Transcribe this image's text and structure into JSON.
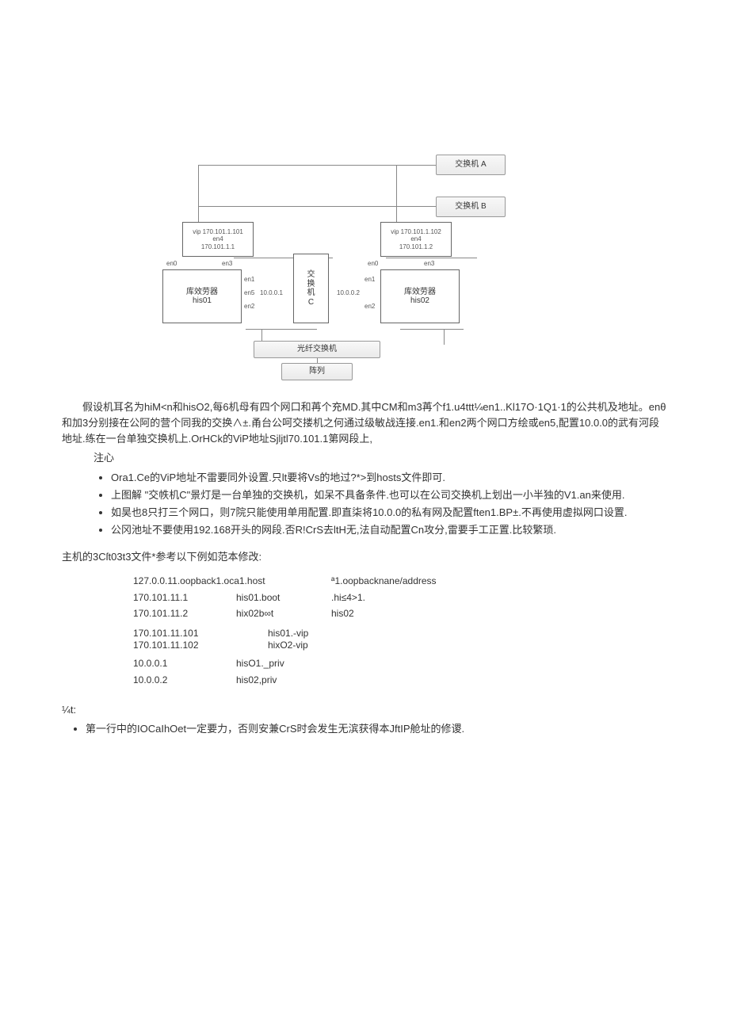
{
  "diagram": {
    "switchA": "交换机 A",
    "switchB": "交换机 B",
    "switchC_l1": "交",
    "switchC_l2": "换",
    "switchC_l3": "机",
    "switchC_l4": "C",
    "server1_title": "库效劳器",
    "server1_name": "his01",
    "server2_title": "库效劳器",
    "server2_name": "his02",
    "vip1_l1": "vip 170.101.1.101",
    "vip1_l2": "en4",
    "vip1_l3": "170.101.1.1",
    "vip2_l1": "vip 170.101.1.102",
    "vip2_l2": "en4",
    "vip2_l3": "170.101.1.2",
    "p_en0_1": "en0",
    "p_en3_1": "en3",
    "p_en1_1": "en1",
    "p_en5_1": "en5",
    "p_en2_1": "en2",
    "p_ip1": "10.0.0.1",
    "p_en0_2": "en0",
    "p_en3_2": "en3",
    "p_en1_2": "en1",
    "p_ip2": "10.0.0.2",
    "p_en2_2": "en2",
    "fc_switch": "光纤交换机",
    "array": "阵列"
  },
  "body": {
    "p1": "假设机耳名为hiM<n和hisO2,每6机母有四个网口和苒个充MD.其中CM和m3苒个f1.u4ttt¼en1..Kl17O·1Q1·1的公共机及地址。enθ和加3分别接在公阿的营个同我的交换∧±.甬台公呵交搂机之何通过级敏战连接.en1.和en2两个网口方绘或en5,配置10.0.0的武有河段地址.练在一台单独交换机上.OrHCk的ViP地址Sjljtl70.101.1第网段上,",
    "p2": "注心",
    "b1": "Ora1.Ce的ViP地址不雷要同外设置.只lt要将Vs的地过?*>到hosts文件即可.",
    "b2": "上图解 \"交帙机C\"景灯是一台单独的交换机，如呆不具备条件.也可以在公司交换机上划出一小半独的V1.an来使用.",
    "b3": "如昊也8只打三个网口，则7院只能使用单用配置.即直柒将10.0.0的私有网及配置ften1.BP±.不再使用虚拟网口设置.",
    "b4": "公冈池址不要使用192.168开头的网段.否R!CrS去ltH无,法自动配置Cn攻分,雷要手工正置.比较繁琐.",
    "p3": "主机的3Cſt03t3文件*参考以下例如范本修改:",
    "note_label": "¼t:",
    "note1": "第一行中的IOCaIhOet一定要力，否则安兼CrS时会发生无滨获得本JftIP舱址的修谡."
  },
  "hosts": {
    "r1c1": "127.0.0.11.oopback1.oca1.host",
    "r1c3": "ª1.oopbacknane/address",
    "r2c1": "170.101.11.1",
    "r2c2": "his01.boot",
    "r2c3": ".hi≤4>1.",
    "r3c1": "170.101.11.2",
    "r3c2": "hix02b∞t",
    "r3c3": "his02",
    "r4c1": "170.101.11.101",
    "r4c2": "his01.-vip",
    "r5c1": "170.101.11.102",
    "r5c2": "hixO2-vip",
    "r6c1": "10.0.0.1",
    "r6c2": "hisO1._priv",
    "r7c1": "10.0.0.2",
    "r7c2": "his02,priv"
  }
}
